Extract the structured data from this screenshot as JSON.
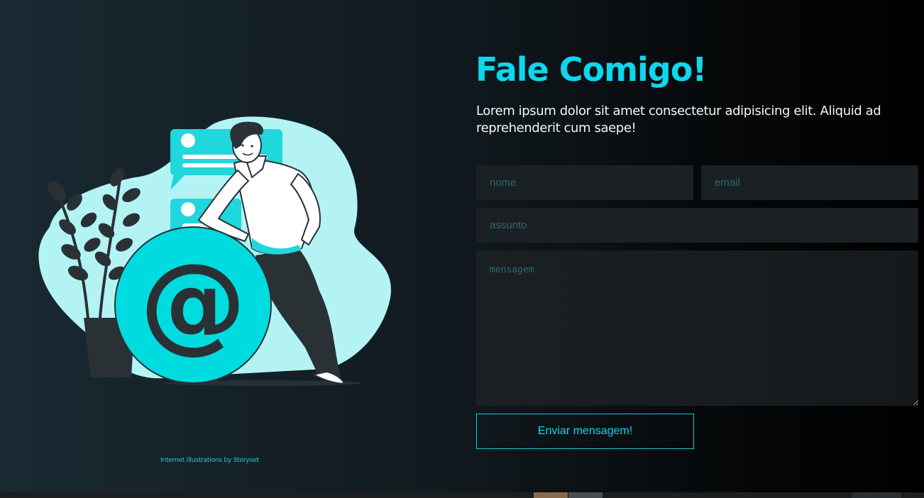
{
  "contact": {
    "title": "Fale Comigo!",
    "intro": "Lorem ipsum dolor sit amet consectetur adipisicing elit. Aliquid ad reprehenderit cum saepe!",
    "credit": "Internet illustrations by Storyset",
    "form": {
      "name_placeholder": "nome",
      "email_placeholder": "email",
      "subject_placeholder": "assunto",
      "message_placeholder": "mensagem",
      "submit_label": "Enviar mensagem!"
    }
  },
  "illustration": {
    "symbol": "@",
    "icons": [
      "email-illustration",
      "plant-icon",
      "chat-bubble-icon",
      "at-sign-icon",
      "person-figure"
    ]
  },
  "colors": {
    "accent": "#0fd6ef",
    "blob": "#b3f3f4",
    "at_circle": "#00dbe0",
    "dark": "#2a3135",
    "field_bg": "#1a2023",
    "placeholder": "#2d6a72"
  }
}
